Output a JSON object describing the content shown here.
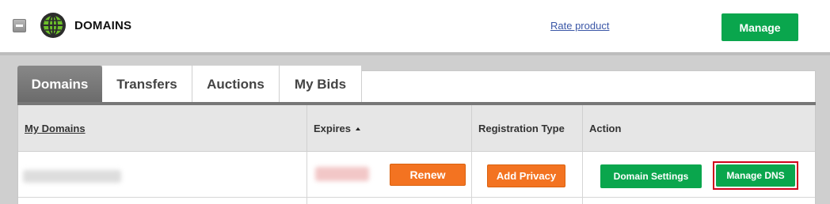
{
  "header": {
    "title": "DOMAINS",
    "rate_link": "Rate product",
    "manage_label": "Manage"
  },
  "tabs": [
    {
      "label": "Domains",
      "active": true
    },
    {
      "label": "Transfers",
      "active": false
    },
    {
      "label": "Auctions",
      "active": false
    },
    {
      "label": "My Bids",
      "active": false
    }
  ],
  "table": {
    "columns": [
      "My Domains",
      "Expires",
      "Registration Type",
      "Action"
    ],
    "sort_column": "Expires",
    "sort_direction": "ascending",
    "rows": [
      {
        "domain": "",
        "expires": "",
        "renew_label": "Renew",
        "privacy_label": "Add Privacy",
        "settings_label": "Domain Settings",
        "dns_label": "Manage DNS"
      }
    ]
  },
  "colors": {
    "green": "#0aa64d",
    "orange": "#f37321",
    "highlight": "#d0021b",
    "link": "#3b57a7"
  },
  "icons": [
    "collapse-icon",
    "globe-icon",
    "sort-ascending-icon"
  ]
}
